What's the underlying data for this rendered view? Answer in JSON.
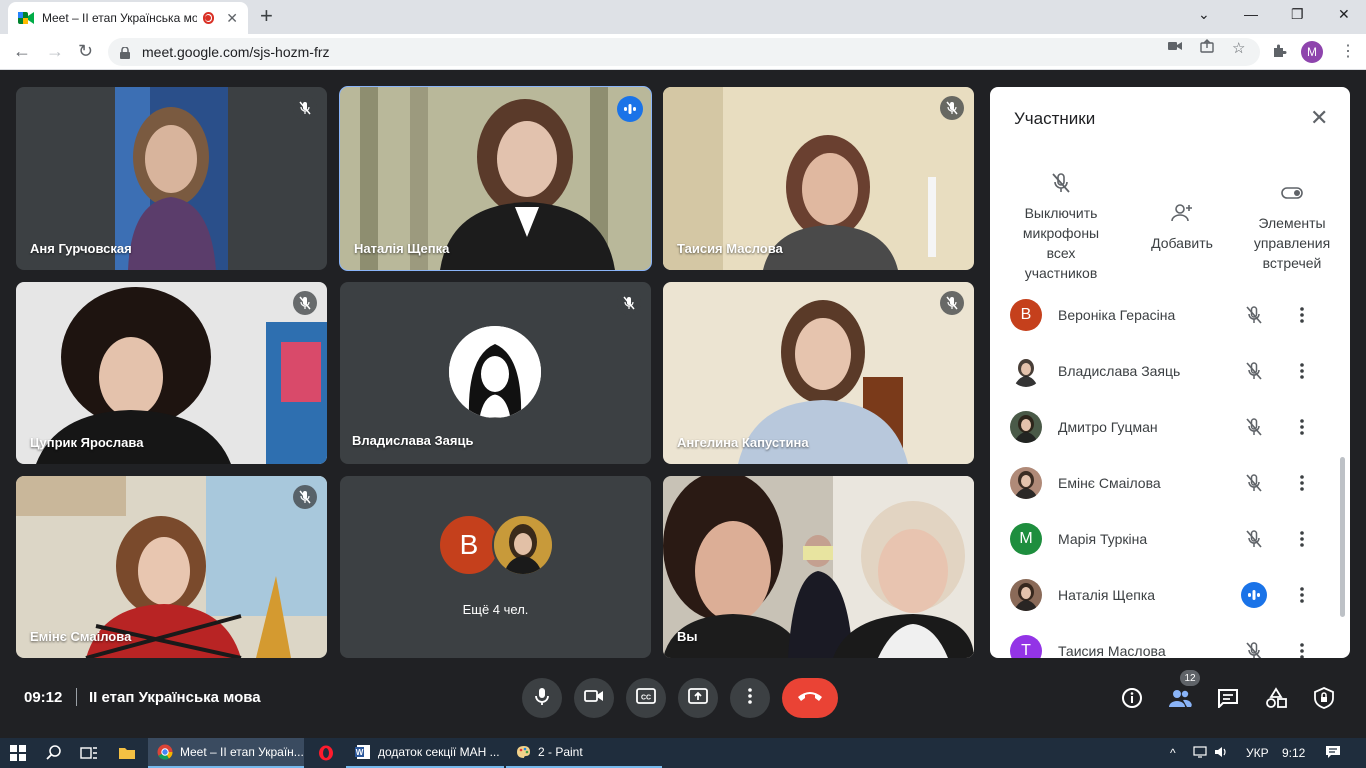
{
  "browser": {
    "tab_title": "Meet – II етап Українська мо",
    "url": "meet.google.com/sjs-hozm-frz",
    "profile_initial": "M"
  },
  "tiles": [
    {
      "name": "Аня Гурчовская"
    },
    {
      "name": "Наталія Щепка"
    },
    {
      "name": "Таисия Маслова"
    },
    {
      "name": "Цуприк Ярослава"
    },
    {
      "name": "Владислава Заяць"
    },
    {
      "name": "Ангелина Капустина"
    },
    {
      "name": "Емінє Смаілова"
    },
    {
      "name": "Ещё 4 чел.",
      "avatar_letter": "В"
    },
    {
      "name": "Вы"
    }
  ],
  "panel": {
    "title": "Участники",
    "actions": {
      "mute_all": "Выключить микрофоны всех участников",
      "add": "Добавить",
      "controls": "Элементы управления встречей"
    },
    "participants": [
      {
        "name": "Вероніка Герасіна",
        "initial": "В",
        "color": "#c5401c",
        "speaking": false
      },
      {
        "name": "Владислава Заяць",
        "initial": "",
        "color": "#ffffff",
        "speaking": false
      },
      {
        "name": "Дмитро Гуцман",
        "initial": "",
        "color": "#4a5a48",
        "speaking": false
      },
      {
        "name": "Емінє Смаілова",
        "initial": "",
        "color": "#b08a78",
        "speaking": false
      },
      {
        "name": "Марія Туркіна",
        "initial": "M",
        "color": "#1e8e3e",
        "speaking": false
      },
      {
        "name": "Наталія Щепка",
        "initial": "",
        "color": "#8a6a58",
        "speaking": true
      },
      {
        "name": "Таисия Маслова",
        "initial": "T",
        "color": "#9334e6",
        "speaking": false
      }
    ]
  },
  "meeting": {
    "time": "09:12",
    "name": "II етап Українська мова",
    "participant_count": "12"
  },
  "taskbar": {
    "chrome_item": "Meet – II етап Україн...",
    "word_item": "додаток секції МАН ...",
    "paint_item": "2 - Paint",
    "lang": "УКР",
    "clock": "9:12"
  }
}
